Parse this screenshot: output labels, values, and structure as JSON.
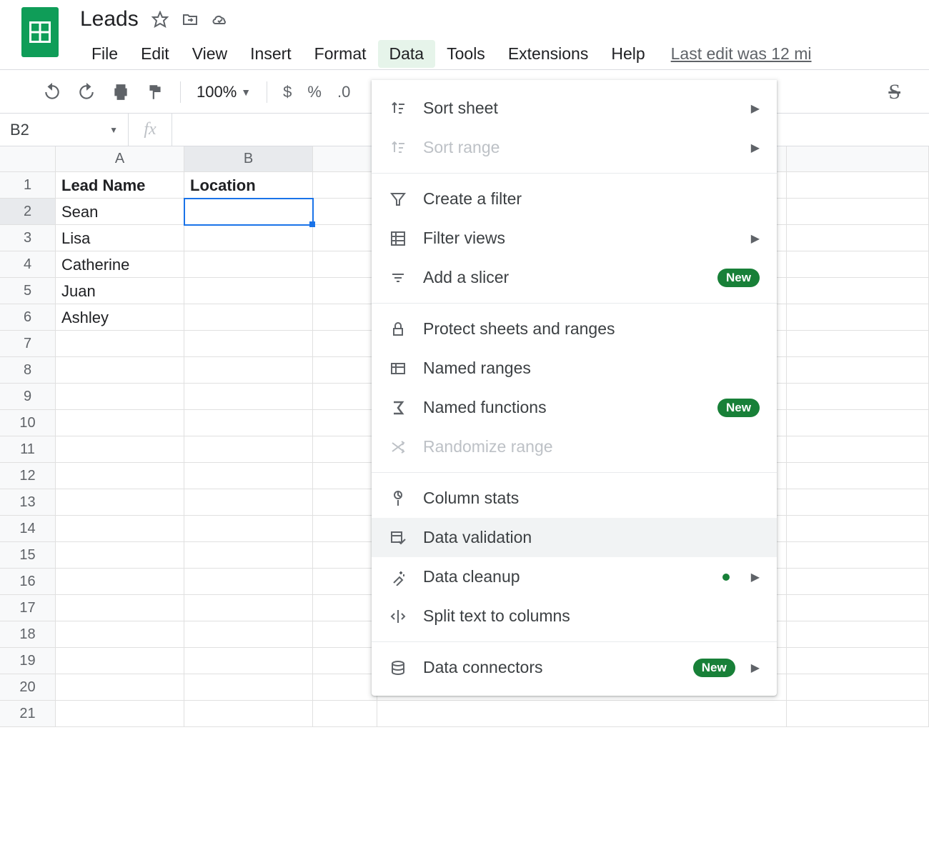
{
  "doc_title": "Leads",
  "last_edit": "Last edit was 12 mi",
  "menubar": [
    "File",
    "Edit",
    "View",
    "Insert",
    "Format",
    "Data",
    "Tools",
    "Extensions",
    "Help"
  ],
  "active_menu_index": 5,
  "toolbar": {
    "zoom": "100%",
    "currency": "$",
    "percent": "%",
    "decimal": ".0"
  },
  "namebox": "B2",
  "columns": [
    "A",
    "B"
  ],
  "rows": {
    "1": {
      "A": "Lead Name",
      "B": "Location"
    },
    "2": {
      "A": "Sean",
      "B": ""
    },
    "3": {
      "A": "Lisa",
      "B": ""
    },
    "4": {
      "A": "Catherine",
      "B": ""
    },
    "5": {
      "A": "Juan",
      "B": ""
    },
    "6": {
      "A": "Ashley",
      "B": ""
    }
  },
  "selected_cell": "B2",
  "dropdown": {
    "items": [
      {
        "label": "Sort sheet",
        "submenu": true
      },
      {
        "label": "Sort range",
        "submenu": true,
        "disabled": true
      },
      {
        "sep": true
      },
      {
        "label": "Create a filter"
      },
      {
        "label": "Filter views",
        "submenu": true
      },
      {
        "label": "Add a slicer",
        "badge": "New"
      },
      {
        "sep": true
      },
      {
        "label": "Protect sheets and ranges"
      },
      {
        "label": "Named ranges"
      },
      {
        "label": "Named functions",
        "badge": "New"
      },
      {
        "label": "Randomize range",
        "disabled": true
      },
      {
        "sep": true
      },
      {
        "label": "Column stats"
      },
      {
        "label": "Data validation",
        "hover": true
      },
      {
        "label": "Data cleanup",
        "dot": true,
        "submenu": true
      },
      {
        "label": "Split text to columns"
      },
      {
        "sep": true
      },
      {
        "label": "Data connectors",
        "badge": "New",
        "submenu": true
      }
    ]
  }
}
